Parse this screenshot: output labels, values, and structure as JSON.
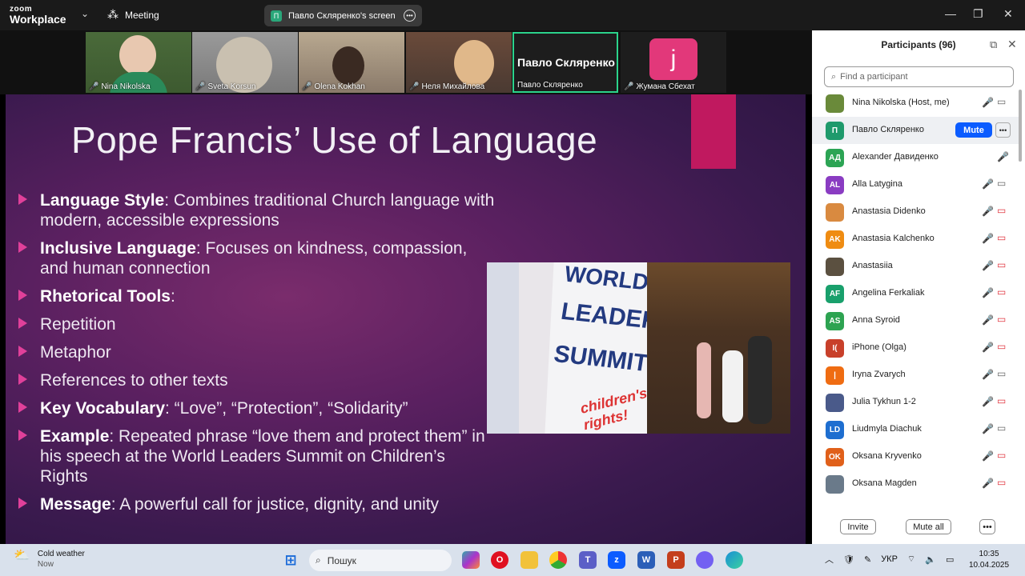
{
  "app": {
    "brand_line1": "zoom",
    "brand_line2": "Workplace",
    "meeting_label": "Meeting",
    "share_label": "Павло Скляренко's screen",
    "share_avatar": "П"
  },
  "video_strip": [
    {
      "name": "Nina Nikolska"
    },
    {
      "name": "Sveta Korsun"
    },
    {
      "name": "Olena Kokhan"
    },
    {
      "name": "Неля Михайлова"
    },
    {
      "name": "Павло Скляренко",
      "big_label": "Павло Скляренко"
    },
    {
      "name": "Жумана Сбехат",
      "initial": "j"
    }
  ],
  "slide": {
    "title": "Pope Francis’ Use of Language",
    "bullets": [
      {
        "bold": "Language Style",
        "text": ": Combines traditional Church language with modern, accessible expressions"
      },
      {
        "bold": "Inclusive Language",
        "text": ": Focuses on kindness, compassion, and human connection"
      },
      {
        "bold": "Rhetorical Tools",
        "text": ":"
      },
      {
        "bold": "",
        "text": "Repetition"
      },
      {
        "bold": "",
        "text": "Metaphor"
      },
      {
        "bold": "",
        "text": "References to other texts"
      },
      {
        "bold": "Key Vocabulary",
        "text": ": “Love”, “Protection”, “Solidarity”"
      },
      {
        "bold": "Example",
        "text": ": Repeated phrase “love them and protect them” in his speech at the World Leaders Summit on Children’s Rights"
      },
      {
        "bold": "Message",
        "text": ": A powerful call for justice, dignity, and unity"
      }
    ],
    "photo_sign": {
      "l1": "WORLD",
      "l2": "LEADERS",
      "l3": "SUMMIT",
      "l4": "children's rights!"
    }
  },
  "participants": {
    "title": "Participants (96)",
    "search_placeholder": "Find a participant",
    "mute_label": "Mute",
    "invite_label": "Invite",
    "mute_all_label": "Mute all",
    "items": [
      {
        "name": "Nina Nikolska (Host, me)",
        "initials": "",
        "color": "#6a8a3a",
        "cam": "on"
      },
      {
        "name": "Павло Скляренко",
        "initials": "П",
        "color": "#1f9a6c",
        "cam": "none"
      },
      {
        "name": "Alexander Давиденко",
        "initials": "АД",
        "color": "#2ca454",
        "cam": "none"
      },
      {
        "name": "Alla Latygina",
        "initials": "AL",
        "color": "#8a3cc2",
        "cam": "on"
      },
      {
        "name": "Anastasia Didenko",
        "initials": "",
        "color": "#d98a40",
        "cam": "off"
      },
      {
        "name": "Anastasia Kalchenko",
        "initials": "AK",
        "color": "#ef8c12",
        "cam": "off"
      },
      {
        "name": "Anastasiia",
        "initials": "",
        "color": "#5b5040",
        "cam": "off"
      },
      {
        "name": "Angelina Ferkaliak",
        "initials": "AF",
        "color": "#19a06c",
        "cam": "off"
      },
      {
        "name": "Anna Syroid",
        "initials": "AS",
        "color": "#2da351",
        "cam": "off"
      },
      {
        "name": "iPhone (Olga)",
        "initials": "I(",
        "color": "#c8402a",
        "cam": "off"
      },
      {
        "name": "Iryna Zvarych",
        "initials": "|",
        "color": "#ef6c12",
        "cam": "on"
      },
      {
        "name": "Julia Tykhun 1-2",
        "initials": "",
        "color": "#4a5a8a",
        "cam": "off"
      },
      {
        "name": "Liudmyla Diachuk",
        "initials": "LD",
        "color": "#1e6ed0",
        "cam": "on"
      },
      {
        "name": "Oksana Kryvenko",
        "initials": "OK",
        "color": "#e0601a",
        "cam": "off"
      },
      {
        "name": "Oksana Magden",
        "initials": "",
        "color": "#6a7a8a",
        "cam": "off"
      }
    ]
  },
  "taskbar": {
    "weather_title": "Cold weather",
    "weather_sub": "Now",
    "search_placeholder": "Пошук",
    "lang": "УКР",
    "time": "10:35",
    "date": "10.04.2025"
  }
}
